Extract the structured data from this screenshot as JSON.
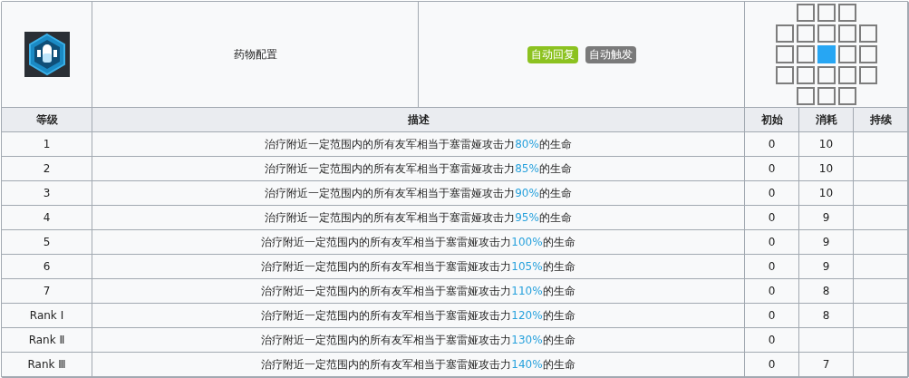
{
  "skill": {
    "name": "药物配置",
    "tags": [
      {
        "label": "自动回复",
        "color": "#8cc220"
      },
      {
        "label": "自动触发",
        "color": "#7a7a7a"
      }
    ],
    "range": [
      [
        {
          "kind": "none"
        },
        {
          "kind": "tile"
        },
        {
          "kind": "tile"
        },
        {
          "kind": "tile"
        },
        {
          "kind": "none"
        }
      ],
      [
        {
          "kind": "tile"
        },
        {
          "kind": "tile"
        },
        {
          "kind": "tile"
        },
        {
          "kind": "tile"
        },
        {
          "kind": "tile"
        }
      ],
      [
        {
          "kind": "tile"
        },
        {
          "kind": "tile"
        },
        {
          "kind": "self"
        },
        {
          "kind": "tile"
        },
        {
          "kind": "tile"
        }
      ],
      [
        {
          "kind": "tile"
        },
        {
          "kind": "tile"
        },
        {
          "kind": "tile"
        },
        {
          "kind": "tile"
        },
        {
          "kind": "tile"
        }
      ],
      [
        {
          "kind": "none"
        },
        {
          "kind": "tile"
        },
        {
          "kind": "tile"
        },
        {
          "kind": "tile"
        },
        {
          "kind": "none"
        }
      ]
    ]
  },
  "table": {
    "columns": [
      "等级",
      "描述",
      "初始",
      "消耗",
      "持续"
    ],
    "rows": [
      {
        "level": "1",
        "prefix": "治疗附近一定范围内的所有友军相当于塞雷娅攻击力",
        "value": "80%",
        "suffix": "的生命",
        "initial": "0",
        "cost": "10"
      },
      {
        "level": "2",
        "prefix": "治疗附近一定范围内的所有友军相当于塞雷娅攻击力",
        "value": "85%",
        "suffix": "的生命",
        "initial": "0",
        "cost": "10"
      },
      {
        "level": "3",
        "prefix": "治疗附近一定范围内的所有友军相当于塞雷娅攻击力",
        "value": "90%",
        "suffix": "的生命",
        "initial": "0",
        "cost": "10"
      },
      {
        "level": "4",
        "prefix": "治疗附近一定范围内的所有友军相当于塞雷娅攻击力",
        "value": "95%",
        "suffix": "的生命",
        "initial": "0",
        "cost": "9"
      },
      {
        "level": "5",
        "prefix": "治疗附近一定范围内的所有友军相当于塞雷娅攻击力",
        "value": "100%",
        "suffix": "的生命",
        "initial": "0",
        "cost": "9"
      },
      {
        "level": "6",
        "prefix": "治疗附近一定范围内的所有友军相当于塞雷娅攻击力",
        "value": "105%",
        "suffix": "的生命",
        "initial": "0",
        "cost": "9"
      },
      {
        "level": "7",
        "prefix": "治疗附近一定范围内的所有友军相当于塞雷娅攻击力",
        "value": "110%",
        "suffix": "的生命",
        "initial": "0",
        "cost": "8"
      },
      {
        "level": "Rank Ⅰ",
        "prefix": "治疗附近一定范围内的所有友军相当于塞雷娅攻击力",
        "value": "120%",
        "suffix": "的生命",
        "initial": "0",
        "cost": "8"
      },
      {
        "level": "Rank Ⅱ",
        "prefix": "治疗附近一定范围内的所有友军相当于塞雷娅攻击力",
        "value": "130%",
        "suffix": "的生命",
        "initial": "0"
      },
      {
        "level": "Rank Ⅲ",
        "prefix": "治疗附近一定范围内的所有友军相当于塞雷娅攻击力",
        "value": "140%",
        "suffix": "的生命",
        "initial": "0",
        "cost": "7"
      }
    ]
  }
}
